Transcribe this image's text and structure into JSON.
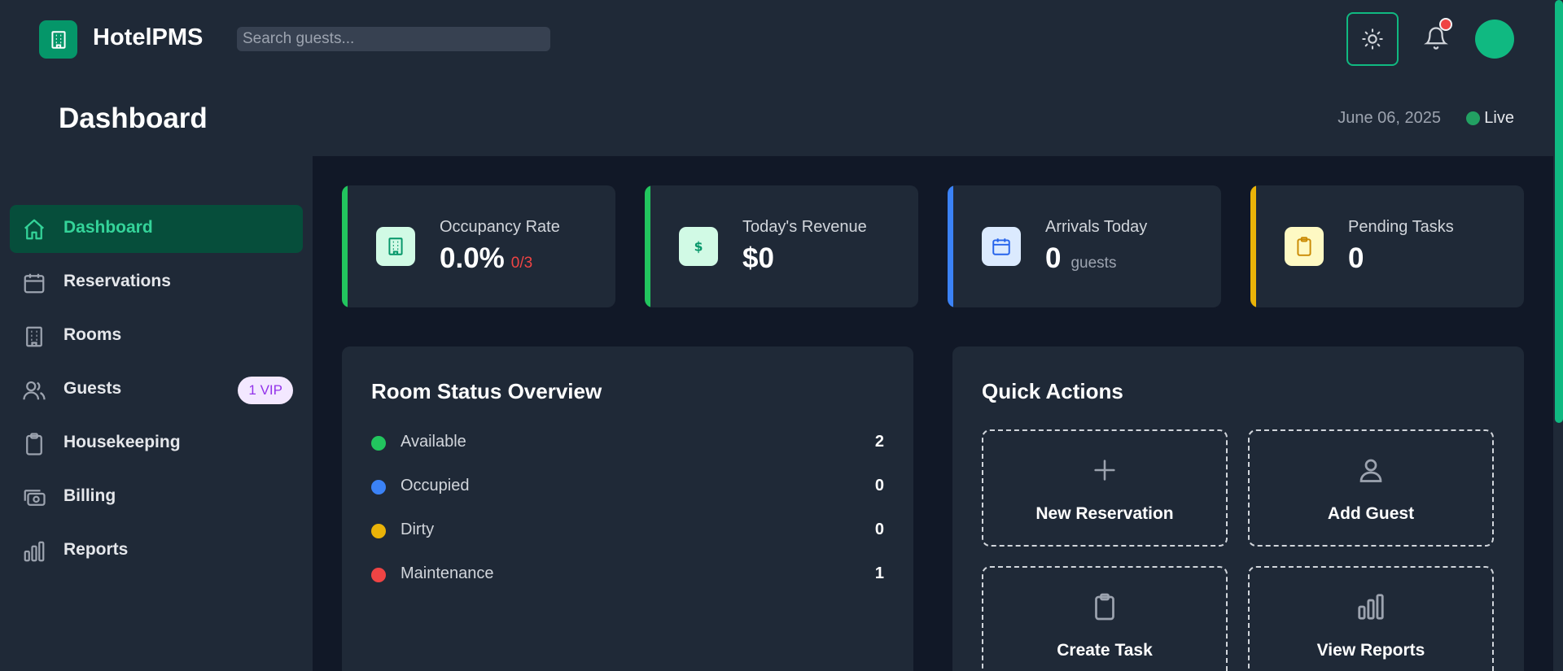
{
  "app": {
    "name": "HotelPMS",
    "search_placeholder": "Search guests..."
  },
  "header": {
    "title": "Dashboard",
    "date": "June 06, 2025",
    "live_label": "Live"
  },
  "sidebar": {
    "items": [
      {
        "label": "Dashboard",
        "icon": "home-icon",
        "active": true
      },
      {
        "label": "Reservations",
        "icon": "calendar-icon"
      },
      {
        "label": "Rooms",
        "icon": "building-icon"
      },
      {
        "label": "Guests",
        "icon": "users-icon",
        "badge": "1 VIP"
      },
      {
        "label": "Housekeeping",
        "icon": "clipboard-icon"
      },
      {
        "label": "Billing",
        "icon": "cash-icon"
      },
      {
        "label": "Reports",
        "icon": "bar-chart-icon"
      }
    ]
  },
  "stats": [
    {
      "label": "Occupancy Rate",
      "value": "0.0%",
      "sub": "0/3",
      "icon": "building-icon",
      "accent": "#22c55e"
    },
    {
      "label": "Today's Revenue",
      "value": "$0",
      "sub": "",
      "icon": "dollar-icon",
      "accent": "#22c55e"
    },
    {
      "label": "Arrivals Today",
      "value": "0",
      "sub": "guests",
      "icon": "calendar-icon",
      "accent": "#3b82f6"
    },
    {
      "label": "Pending Tasks",
      "value": "0",
      "sub": "",
      "icon": "clipboard-icon",
      "accent": "#eab308"
    }
  ],
  "room_status": {
    "title": "Room Status Overview",
    "rows": [
      {
        "label": "Available",
        "count": "2",
        "color": "#22c55e"
      },
      {
        "label": "Occupied",
        "count": "0",
        "color": "#3b82f6"
      },
      {
        "label": "Dirty",
        "count": "0",
        "color": "#eab308"
      },
      {
        "label": "Maintenance",
        "count": "1",
        "color": "#ef4444"
      }
    ]
  },
  "quick_actions": {
    "title": "Quick Actions",
    "buttons": [
      {
        "label": "New Reservation",
        "icon": "plus-icon"
      },
      {
        "label": "Add Guest",
        "icon": "user-icon"
      },
      {
        "label": "Create Task",
        "icon": "clipboard-icon"
      },
      {
        "label": "View Reports",
        "icon": "bar-chart-icon"
      }
    ]
  },
  "colors": {
    "accent": "#10b981",
    "panel": "#1f2937",
    "background": "#111827"
  }
}
